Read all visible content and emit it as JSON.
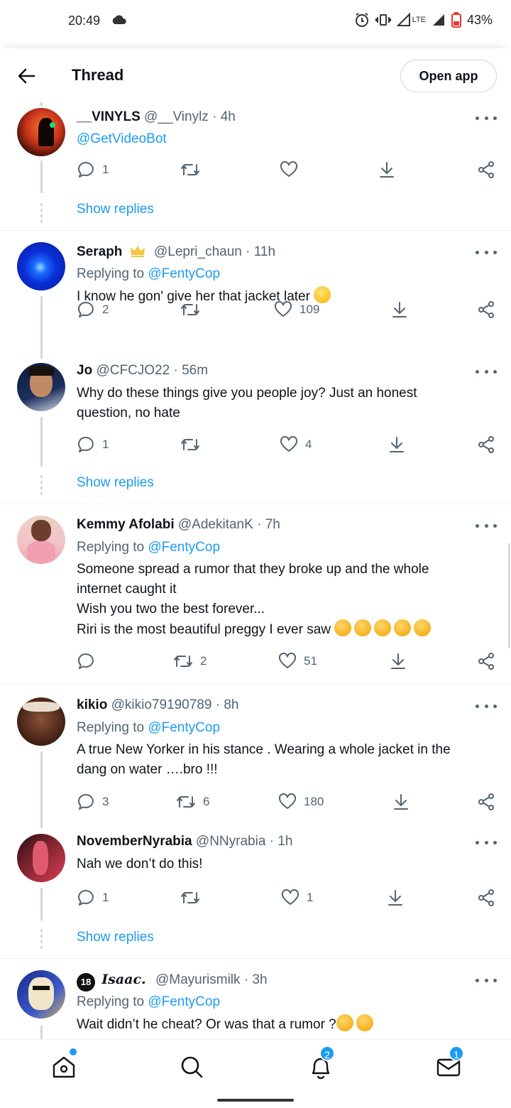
{
  "status_bar": {
    "time": "20:49",
    "battery": "43%",
    "network": "LTE"
  },
  "header": {
    "title": "Thread",
    "open_app": "Open app"
  },
  "show_replies_label": "Show replies",
  "tweets": [
    {
      "name": "__VINYLS",
      "handle": "@__Vinylz",
      "dot": "·",
      "time": "4h",
      "body_link": "@GetVideoBot",
      "replies": "1",
      "retweets": "",
      "likes": ""
    },
    {
      "name": "Seraph",
      "handle": "@Lepri_chaun",
      "dot": "·",
      "time": "11h",
      "replying_prefix": "Replying to",
      "replying_to": "@FentyCop",
      "text": "I know he gon' give her that jacket later",
      "replies": "2",
      "retweets": "",
      "likes": "109"
    },
    {
      "name": "Jo",
      "handle": "@CFCJO22",
      "dot": "·",
      "time": "56m",
      "text_lines": [
        "Why do these things give you people joy? Just an honest",
        "question, no hate"
      ],
      "replies": "1",
      "retweets": "",
      "likes": "4"
    },
    {
      "name": "Kemmy Afolabi",
      "handle": "@AdekitanK",
      "dot": "·",
      "time": "7h",
      "replying_prefix": "Replying to",
      "replying_to": "@FentyCop",
      "text_lines": [
        "Someone spread a rumor that they broke up and the whole",
        "internet caught it",
        "Wish you two the best forever...",
        "Riri is the most beautiful preggy I ever saw"
      ],
      "replies": "",
      "retweets": "2",
      "likes": "51"
    },
    {
      "name": "kikio",
      "handle": "@kikio79190789",
      "dot": "·",
      "time": "8h",
      "replying_prefix": "Replying to",
      "replying_to": "@FentyCop",
      "text_lines": [
        "A true New Yorker in his stance . Wearing a whole jacket in the",
        "dang on water ….bro !!!"
      ],
      "replies": "3",
      "retweets": "6",
      "likes": "180"
    },
    {
      "name": "NovemberNyrabia",
      "handle": "@NNyrabia",
      "dot": "·",
      "time": "1h",
      "text": "Nah we don’t do this!",
      "replies": "1",
      "retweets": "",
      "likes": "1"
    },
    {
      "badge": "18",
      "name": "Isaac.",
      "handle": "@Mayurismilk",
      "dot": "·",
      "time": "3h",
      "replying_prefix": "Replying to",
      "replying_to": "@FentyCop",
      "text": "Wait didn’t he cheat? Or was that a rumor ?"
    }
  ],
  "bottom_nav": {
    "notifications_badge": "2",
    "messages_badge": "1"
  },
  "colors": {
    "accent": "#1d9bf0",
    "text": "#0f1419",
    "muted": "#536471",
    "divider": "#eff3f4"
  }
}
